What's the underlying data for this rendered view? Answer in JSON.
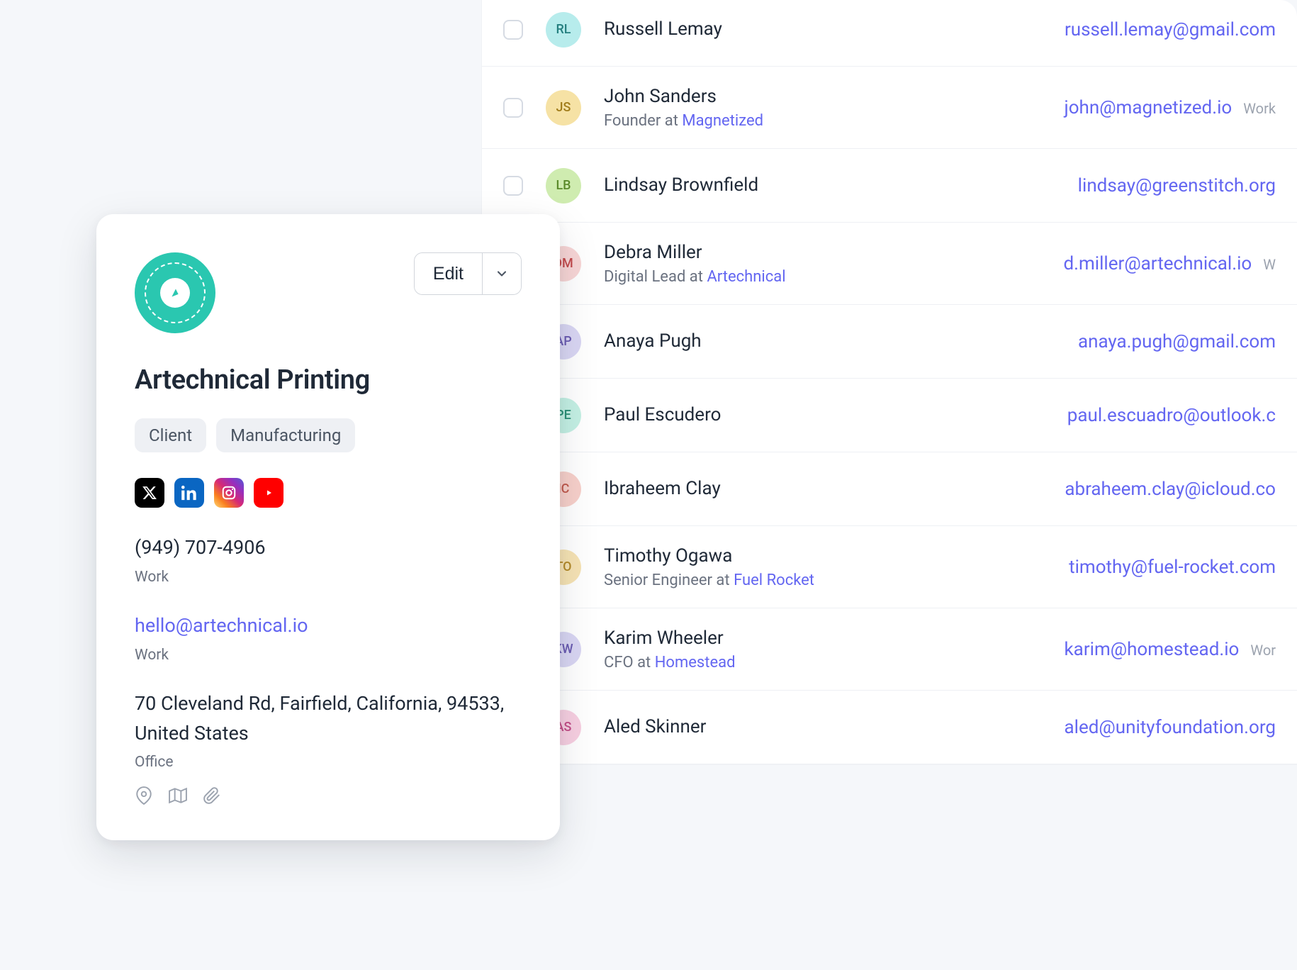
{
  "contacts": [
    {
      "initials": "RL",
      "name": "Russell Lemay",
      "role": "",
      "company": "",
      "email": "russell.lemay@gmail.com",
      "emailLabel": "",
      "avatarBg": "#b7ecec",
      "avatarFg": "#247f7f",
      "checkbox": true
    },
    {
      "initials": "JS",
      "name": "John Sanders",
      "role": "Founder at ",
      "company": "Magnetized",
      "email": "john@magnetized.io",
      "emailLabel": "Work",
      "avatarBg": "#f6e2a5",
      "avatarFg": "#a17c1a",
      "checkbox": true
    },
    {
      "initials": "LB",
      "name": "Lindsay Brownfield",
      "role": "",
      "company": "",
      "email": "lindsay@greenstitch.org",
      "emailLabel": "",
      "avatarBg": "#cfecb0",
      "avatarFg": "#5b8a2b",
      "checkbox": true
    },
    {
      "initials": "DM",
      "name": "Debra Miller",
      "role": "Digital Lead at ",
      "company": "Artechnical",
      "email": "d.miller@artechnical.io",
      "emailLabel": "W",
      "avatarBg": "#f7d5d5",
      "avatarFg": "#c2494b",
      "checkbox": false
    },
    {
      "initials": "AP",
      "name": "Anaya Pugh",
      "role": "",
      "company": "",
      "email": "anaya.pugh@gmail.com",
      "emailLabel": "",
      "avatarBg": "#d9d6f3",
      "avatarFg": "#6a5bb1",
      "checkbox": false
    },
    {
      "initials": "PE",
      "name": "Paul Escudero",
      "role": "",
      "company": "",
      "email": "paul.escuadro@outlook.c",
      "emailLabel": "",
      "avatarBg": "#c4f0e4",
      "avatarFg": "#2b8f76",
      "checkbox": false
    },
    {
      "initials": "IC",
      "name": "Ibraheem Clay",
      "role": "",
      "company": "",
      "email": "abraheem.clay@icloud.co",
      "emailLabel": "",
      "avatarBg": "#f7d0ca",
      "avatarFg": "#c25a4e",
      "checkbox": false
    },
    {
      "initials": "TO",
      "name": "Timothy Ogawa",
      "role": "Senior Engineer at ",
      "company": "Fuel Rocket",
      "email": "timothy@fuel-rocket.com",
      "emailLabel": "",
      "avatarBg": "#f6e3b4",
      "avatarFg": "#b48a2a",
      "checkbox": false
    },
    {
      "initials": "KW",
      "name": "Karim Wheeler",
      "role": "CFO at ",
      "company": "Homestead",
      "email": "karim@homestead.io",
      "emailLabel": "Wor",
      "avatarBg": "#d9d6f3",
      "avatarFg": "#6a5bb1",
      "checkbox": false
    },
    {
      "initials": "AS",
      "name": "Aled Skinner",
      "role": "",
      "company": "",
      "email": "aled@unityfoundation.org",
      "emailLabel": "",
      "avatarBg": "#f7cfe1",
      "avatarFg": "#c24c86",
      "checkbox": false
    }
  ],
  "card": {
    "editLabel": "Edit",
    "title": "Artechnical Printing",
    "tags": [
      "Client",
      "Manufacturing"
    ],
    "phone": {
      "value": "(949) 707-4906",
      "label": "Work"
    },
    "email": {
      "value": "hello@artechnical.io",
      "label": "Work"
    },
    "address": {
      "value": "70 Cleveland Rd, Fairfield, California, 94533, United States",
      "label": "Office"
    }
  }
}
